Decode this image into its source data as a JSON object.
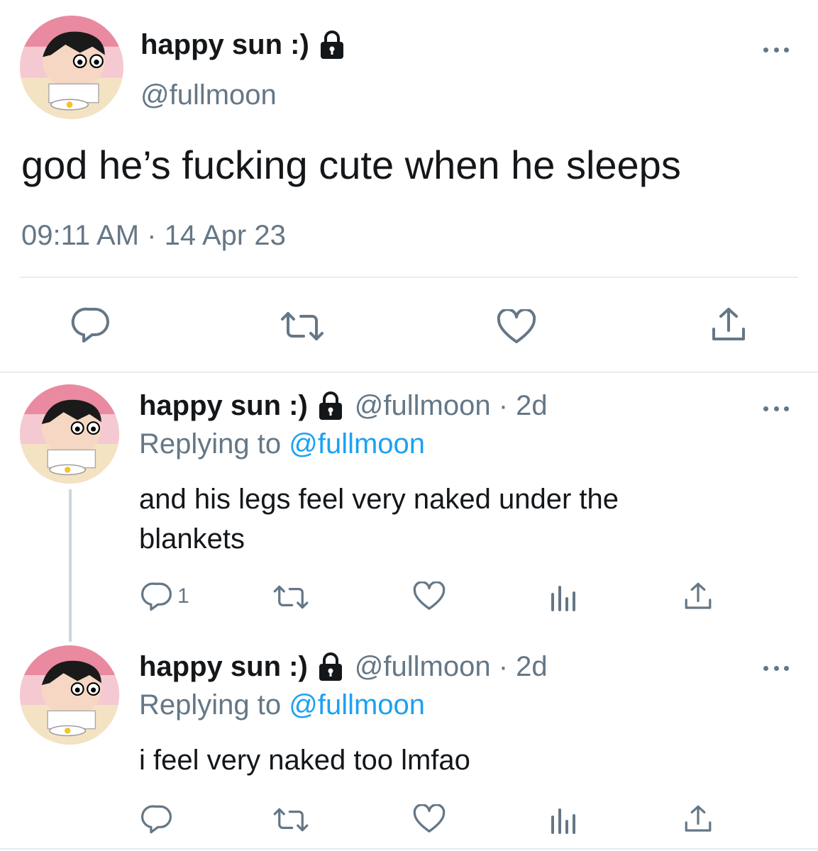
{
  "main_tweet": {
    "display_name": "happy sun :)",
    "handle": "@fullmoon",
    "text": "god he’s fucking cute when he sleeps",
    "timestamp": "09:11 AM · 14 Apr 23",
    "actions": {
      "reply": "reply-icon",
      "retweet": "retweet-icon",
      "like": "heart-icon",
      "share": "share-icon"
    }
  },
  "replies": [
    {
      "display_name": "happy sun :)",
      "handle_time": "@fullmoon · 2d",
      "replying_prefix": "Replying to",
      "replying_handle": "@fullmoon",
      "text_line1": "and his legs feel very naked under the",
      "text_line2": "blankets",
      "reply_count": "1"
    },
    {
      "display_name": "happy sun :)",
      "handle_time": "@fullmoon · 2d",
      "replying_prefix": "Replying to",
      "replying_handle": "@fullmoon",
      "text_line1": "i feel very naked too lmfao",
      "reply_count": ""
    }
  ],
  "colors": {
    "accent": "#1da1f2",
    "secondary": "#657786",
    "text": "#14171a",
    "divider": "#e6ecf0"
  }
}
